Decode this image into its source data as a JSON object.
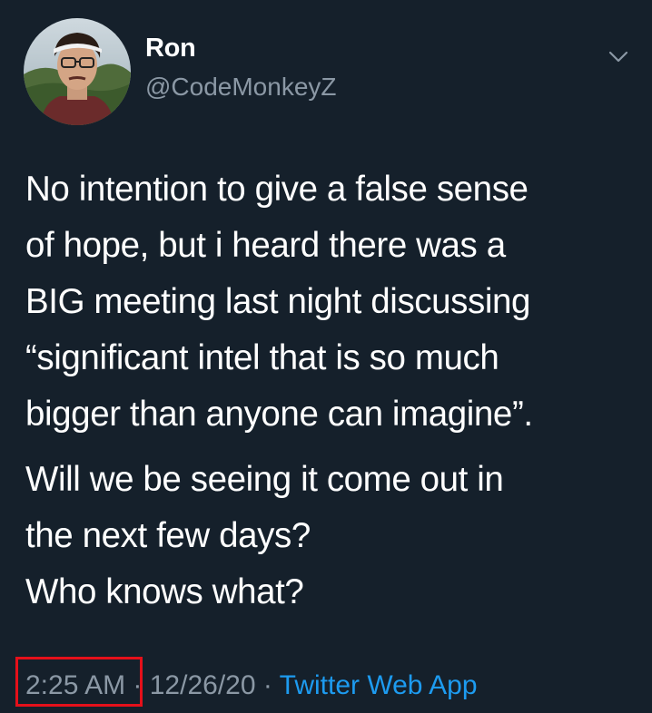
{
  "tweet": {
    "author": {
      "name": "Ron",
      "handle": "@CodeMonkeyZ"
    },
    "menu_icon": "chevron-down-icon",
    "text_lines_p1": [
      "No intention to give a false sense",
      "of hope, but i heard there was a",
      "BIG meeting last night discussing",
      "“significant intel that is so much",
      "bigger than anyone can imagine”."
    ],
    "text_lines_p2": [
      "Will we be seeing it come out in",
      "the next few days?",
      "Who knows what?"
    ],
    "time": "2:25 AM",
    "separator": " · ",
    "date": "12/26/20",
    "source": "Twitter Web App"
  },
  "colors": {
    "background": "#15202b",
    "text": "#ffffff",
    "muted": "#8b98a5",
    "link": "#1d9bf0",
    "highlight": "#e5101a"
  }
}
